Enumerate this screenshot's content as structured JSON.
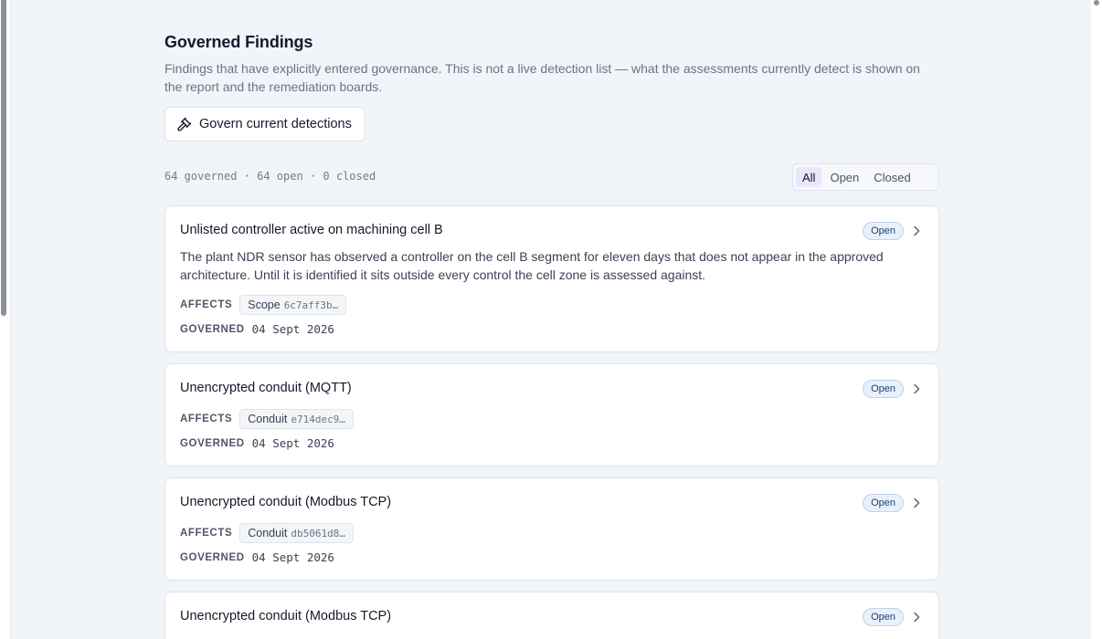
{
  "page": {
    "title": "Governed Findings",
    "description": "Findings that have explicitly entered governance. This is not a live detection list — what the assessments currently detect is shown on the report and the remediation boards.",
    "govern_button": "Govern current detections",
    "summary": "64 governed · 64 open · 0 closed"
  },
  "filters": [
    "All",
    "Open",
    "Closed"
  ],
  "filter_selected": "All",
  "labels": {
    "affects": "AFFECTS",
    "governed": "GOVERNED"
  },
  "findings": [
    {
      "title": "Unlisted controller active on machining cell B",
      "status": "Open",
      "description": "The plant NDR sensor has observed a controller on the cell B segment for eleven days that does not appear in the approved architecture. Until it is identified it sits outside every control the cell zone is assessed against.",
      "affects_type": "Scope",
      "affects_id": "6c7aff3b…",
      "governed_date": "04 Sept 2026"
    },
    {
      "title": "Unencrypted conduit (MQTT)",
      "status": "Open",
      "description": "",
      "affects_type": "Conduit",
      "affects_id": "e714dec9…",
      "governed_date": "04 Sept 2026"
    },
    {
      "title": "Unencrypted conduit (Modbus TCP)",
      "status": "Open",
      "description": "",
      "affects_type": "Conduit",
      "affects_id": "db5061d8…",
      "governed_date": "04 Sept 2026"
    },
    {
      "title": "Unencrypted conduit (Modbus TCP)",
      "status": "Open",
      "description": "",
      "affects_type": "Conduit",
      "affects_id": "",
      "governed_date": ""
    }
  ],
  "icons": {
    "govern": "gavel-icon",
    "row_open": "chevron-right-icon"
  },
  "colors": {
    "badge_bg": "#e8f0fb",
    "badge_text": "#1f3f7a",
    "filter_active": "#ece5fb"
  }
}
